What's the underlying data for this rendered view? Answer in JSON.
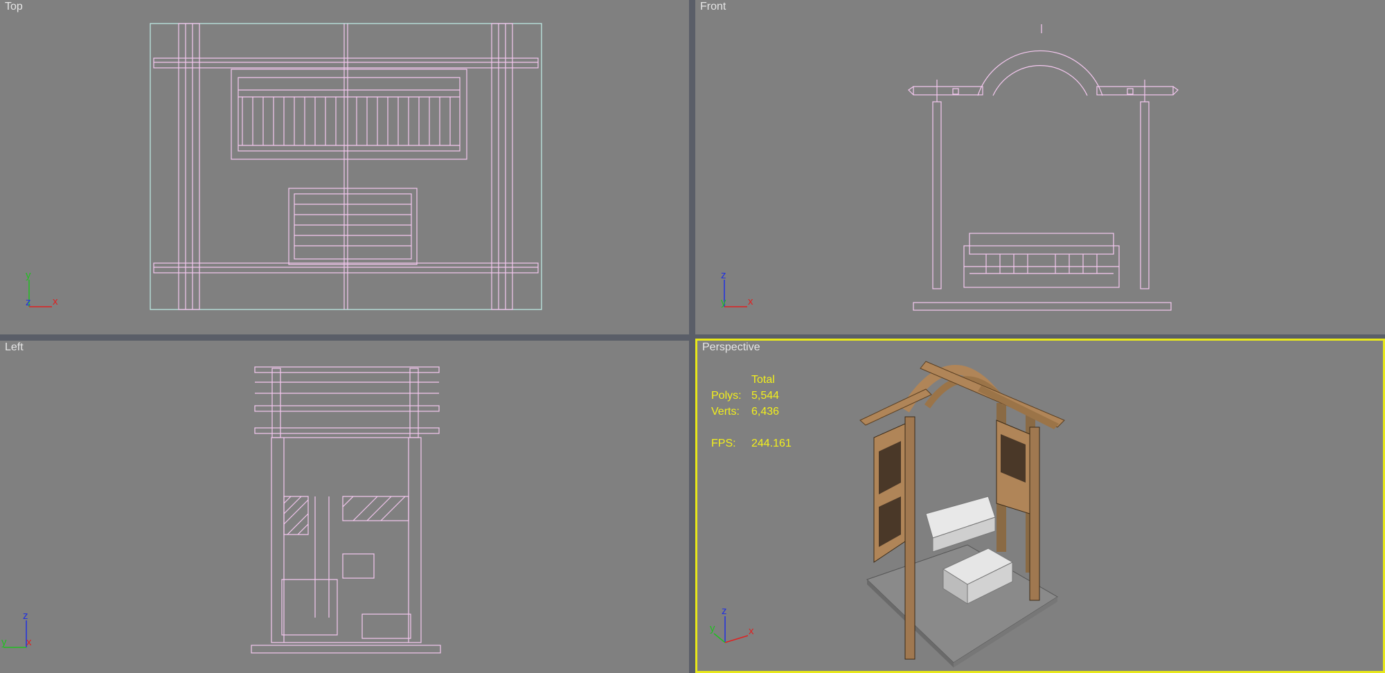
{
  "viewports": {
    "top": {
      "label": "Top",
      "axis": {
        "vertical": "y",
        "horizontal": "x",
        "depth": "z"
      }
    },
    "front": {
      "label": "Front",
      "axis": {
        "vertical": "z",
        "horizontal": "x",
        "depth": "y"
      }
    },
    "left": {
      "label": "Left",
      "axis": {
        "vertical": "z",
        "horizontal": "x",
        "depth": "y"
      }
    },
    "perspective": {
      "label": "Perspective",
      "axis": {
        "vertical": "z",
        "horizontal": "x",
        "depth": "y"
      },
      "stats": {
        "header": "Total",
        "polys_label": "Polys:",
        "polys": "5,544",
        "verts_label": "Verts:",
        "verts": "6,436",
        "fps_label": "FPS:",
        "fps": "244.161"
      }
    }
  },
  "colors": {
    "viewport_bg": "#808080",
    "wireframe": "#f5c8f0",
    "active_border": "#e8e81a",
    "stats_text": "#f2ef1c",
    "wood": "#b08558",
    "axis_x": "#e02020",
    "axis_y": "#20c020",
    "axis_z": "#2030e0"
  }
}
